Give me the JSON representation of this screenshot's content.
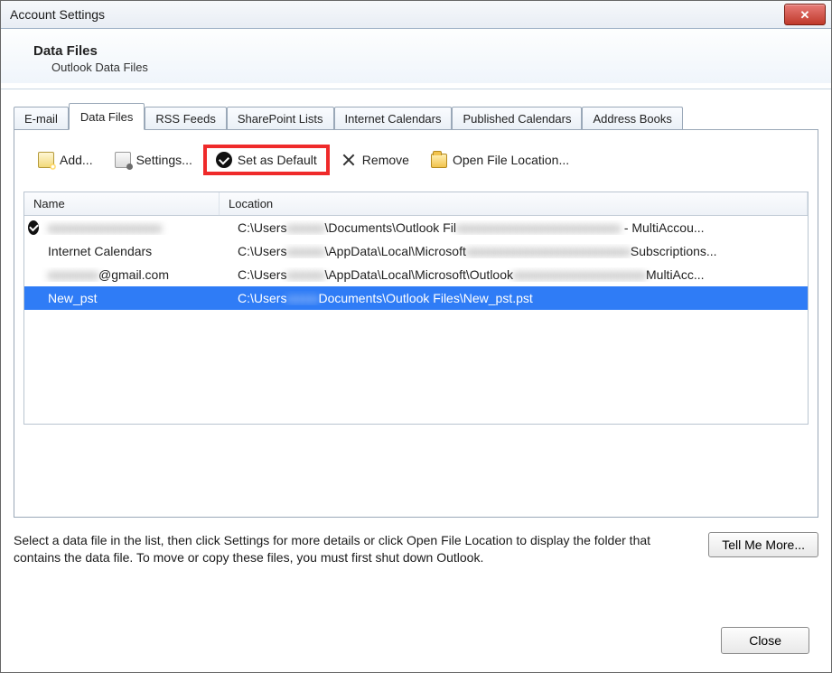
{
  "window": {
    "title": "Account Settings"
  },
  "header": {
    "title": "Data Files",
    "subtitle": "Outlook Data Files"
  },
  "tabs": [
    {
      "label": "E-mail"
    },
    {
      "label": "Data Files"
    },
    {
      "label": "RSS Feeds"
    },
    {
      "label": "SharePoint Lists"
    },
    {
      "label": "Internet Calendars"
    },
    {
      "label": "Published Calendars"
    },
    {
      "label": "Address Books"
    }
  ],
  "active_tab_index": 1,
  "toolbar": {
    "add": "Add...",
    "settings": "Settings...",
    "set_default": "Set as Default",
    "remove": "Remove",
    "open_location": "Open File Location..."
  },
  "columns": {
    "name": "Name",
    "location": "Location"
  },
  "rows": [
    {
      "is_default": true,
      "selected": false,
      "name_visible": "",
      "name_blurred": "xxxxxxxxxxxxxxxxxx",
      "loc_prefix": "C:\\Users",
      "loc_blur1": "xxxxxx",
      "loc_mid": "\\Documents\\Outlook Fil",
      "loc_blur2": "xxxxxxxxxxxxxxxxxxxxxxxxxx",
      "loc_suffix": " - MultiAccou..."
    },
    {
      "is_default": false,
      "selected": false,
      "name_visible": "Internet Calendars",
      "name_blurred": "",
      "loc_prefix": "C:\\Users",
      "loc_blur1": "xxxxxx",
      "loc_mid": "\\AppData\\Local\\Microsoft",
      "loc_blur2": "xxxxxxxxxxxxxxxxxxxxxxxxxx",
      "loc_suffix": "Subscriptions..."
    },
    {
      "is_default": false,
      "selected": false,
      "name_visible": "@gmail.com",
      "name_blurred": "xxxxxxxx",
      "loc_prefix": "C:\\Users",
      "loc_blur1": "xxxxxx",
      "loc_mid": "\\AppData\\Local\\Microsoft\\Outlook",
      "loc_blur2": "xxxxxxxxxxxxxxxxxxxxx",
      "loc_suffix": "MultiAcc..."
    },
    {
      "is_default": false,
      "selected": true,
      "name_visible": "New_pst",
      "name_blurred": "",
      "loc_prefix": "C:\\Users",
      "loc_blur1": "xxxxx",
      "loc_mid": "Documents\\Outlook Files\\New_pst.pst",
      "loc_blur2": "",
      "loc_suffix": ""
    }
  ],
  "help_text": "Select a data file in the list, then click Settings for more details or click Open File Location to display the folder that contains the data file. To move or copy these files, you must first shut down Outlook.",
  "tell_me_more": "Tell Me More...",
  "close": "Close",
  "highlight_overlay": {
    "target": "set-default-button"
  }
}
